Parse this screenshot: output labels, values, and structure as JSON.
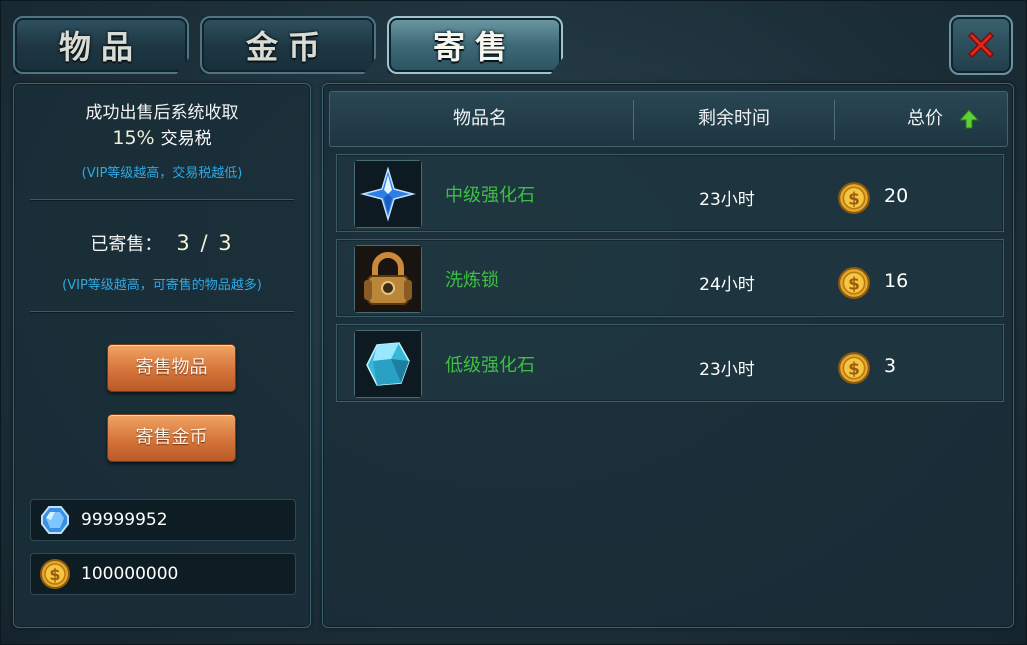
{
  "tabs": [
    {
      "label": "物品"
    },
    {
      "label": "金币"
    },
    {
      "label": "寄售"
    }
  ],
  "left": {
    "tax_text": "成功出售后系统收取",
    "tax_pct": "15%",
    "tax_suffix": "交易税",
    "tax_hint": "(VIP等级越高，交易税越低)",
    "sold_label": "已寄售：",
    "sold_count": "3 / 3",
    "sold_hint": "(VIP等级越高，可寄售的物品越多)",
    "btn_sell_item": "寄售物品",
    "btn_sell_gold": "寄售金币",
    "diamond_amount": "99999952",
    "gold_amount": "100000000"
  },
  "table": {
    "headers": {
      "name": "物品名",
      "time": "剩余时间",
      "price": "总价"
    },
    "sort_icon": "up-arrow-icon",
    "rows": [
      {
        "name": "中级强化石",
        "time": "23小时",
        "price": "20",
        "icon": "blue-crystal-icon"
      },
      {
        "name": "洗炼锁",
        "time": "24小时",
        "price": "16",
        "icon": "padlock-icon"
      },
      {
        "name": "低级强化石",
        "time": "23小时",
        "price": "3",
        "icon": "cyan-gem-icon"
      }
    ]
  },
  "colors": {
    "item_name": "#3cc043",
    "hint": "#2fa8e0",
    "button": "#d5743a"
  }
}
